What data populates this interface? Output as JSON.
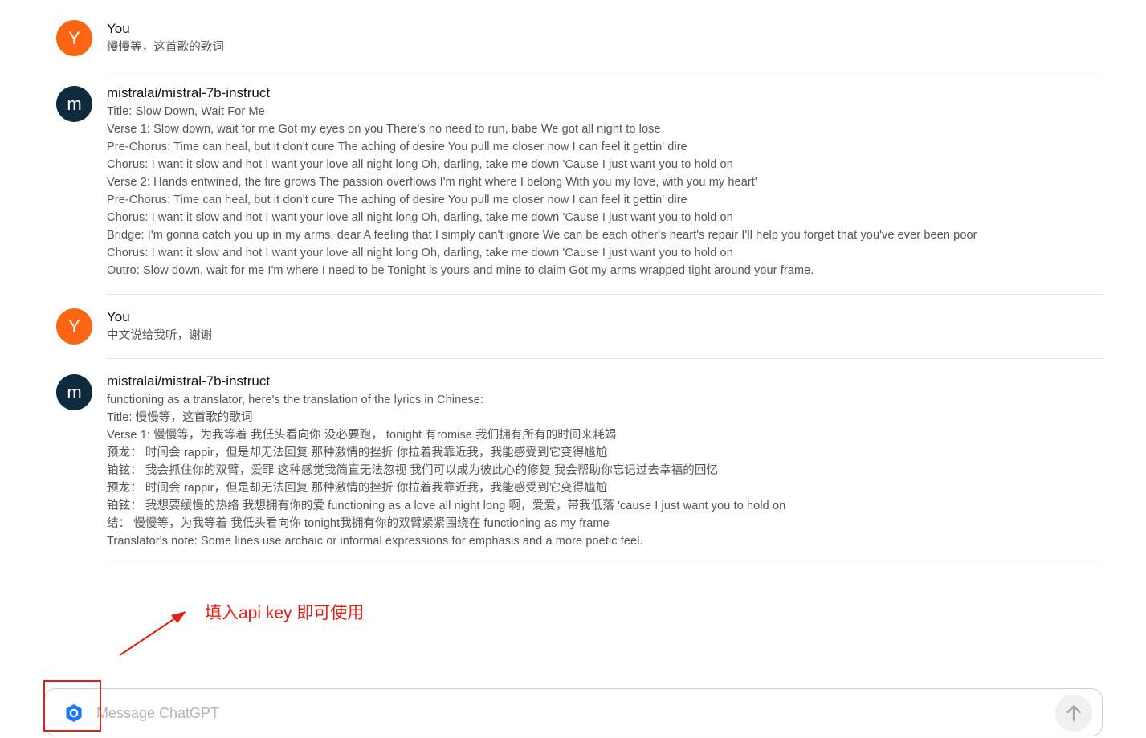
{
  "messages": [
    {
      "role": "user",
      "avatar_letter": "Y",
      "author": "You",
      "lines": [
        "慢慢等，这首歌的歌词"
      ]
    },
    {
      "role": "assistant",
      "avatar_letter": "m",
      "author": "mistralai/mistral-7b-instruct",
      "lines": [
        "Title: Slow Down, Wait For Me",
        "Verse 1: Slow down, wait for me Got my eyes on you There's no need to run, babe We got all night to lose",
        "Pre-Chorus: Time can heal, but it don't cure The aching of desire You pull me closer now I can feel it gettin' dire",
        "Chorus: I want it slow and hot I want your love all night long Oh, darling, take me down 'Cause I just want you to hold on",
        "Verse 2: Hands entwined, the fire grows The passion overflows I'm right where I belong With you my love, with you my heart'",
        "Pre-Chorus: Time can heal, but it don't cure The aching of desire You pull me closer now I can feel it gettin' dire",
        "Chorus: I want it slow and hot I want your love all night long Oh, darling, take me down 'Cause I just want you to hold on",
        "Bridge: I'm gonna catch you up in my arms, dear A feeling that I simply can't ignore We can be each other's heart's repair I'll help you forget that you've ever been poor",
        "Chorus: I want it slow and hot I want your love all night long Oh, darling, take me down 'Cause I just want you to hold on",
        "Outro: Slow down, wait for me I'm where I need to be Tonight is yours and mine to claim Got my arms wrapped tight around your frame."
      ]
    },
    {
      "role": "user",
      "avatar_letter": "Y",
      "author": "You",
      "lines": [
        "中文说给我听，谢谢"
      ]
    },
    {
      "role": "assistant",
      "avatar_letter": "m",
      "author": "mistralai/mistral-7b-instruct",
      "lines": [
        "functioning as a translator, here's the translation of the lyrics in Chinese:",
        "Title: 慢慢等，这首歌的歌词",
        "Verse 1: 慢慢等，为我等着 我低头看向你 没必要跑， tonight 有romise 我们拥有所有的时间来耗竭",
        "预龙： 时间会 rappir，但是却无法回复 那种激情的挫折 你拉着我靠近我，我能感受到它变得尴尬",
        "铂铉： 我会抓住你的双臂，爱罪 这种感觉我简直无法忽视 我们可以成为彼此心的修复 我会帮助你忘记过去幸福的回忆",
        "预龙： 时间会 rappir，但是却无法回复 那种激情的挫折 你拉着我靠近我，我能感受到它变得尴尬",
        "铂铉： 我想要缓慢的热络 我想拥有你的爱 functioning as a love all night long 啊，爱爱，带我低落 'cause I just want you to hold on",
        "结： 慢慢等，为我等着 我低头看向你 tonight我拥有你的双臂紧紧围绕在 functioning as my frame",
        "Translator's note: Some lines use archaic or informal expressions for emphasis and a more poetic feel."
      ]
    }
  ],
  "annotation": {
    "text": "填入api key 即可使用",
    "color": "#e0201b"
  },
  "composer": {
    "placeholder": "Message ChatGPT",
    "value": "",
    "settings_icon": "gear-icon",
    "send_icon": "arrow-up-icon"
  },
  "colors": {
    "user_avatar": "#fb6514",
    "assistant_avatar": "#0f2a3d",
    "settings_icon": "#1677ff"
  }
}
